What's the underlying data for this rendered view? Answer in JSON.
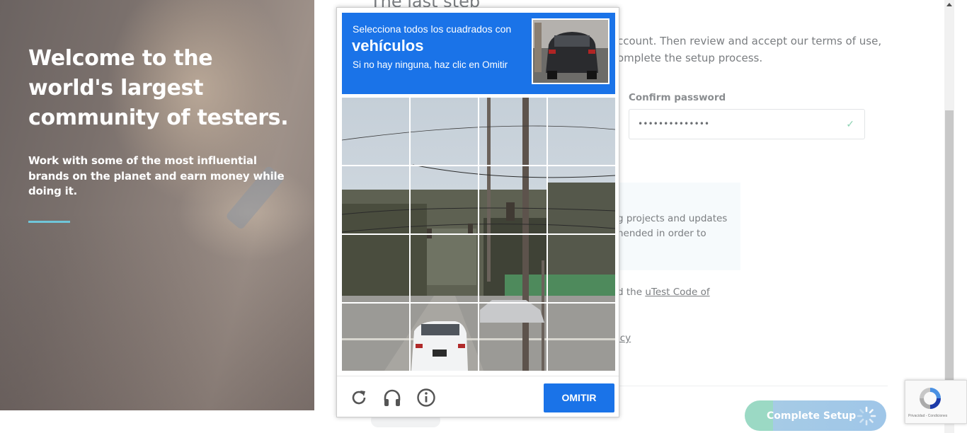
{
  "hero": {
    "headline": "Welcome to the world's largest community of testers.",
    "subtext": "Work with some of the most influential brands on the planet and earn money while doing it."
  },
  "form": {
    "title": "The last step",
    "intro_line1": "ccount. Then review and accept our terms of use,",
    "intro_line2": "omplete the setup process.",
    "confirm_password_label": "Confirm password",
    "confirm_password_value": "••••••••••••••",
    "info_line1": "g projects and updates",
    "info_line2": "nended in order to",
    "code_prefix": "d the",
    "code_link": "uTest Code of",
    "privacy_fragment": "icy",
    "complete_setup_label": "Complete Setup"
  },
  "captcha": {
    "instruction": "Selecciona todos los cuadrados con",
    "target": "vehículos",
    "hint": "Si no hay ninguna, haz clic en Omitir",
    "skip_label": "OMITIR",
    "grid_size": 4,
    "footer_icons": [
      "reload-icon",
      "audio-icon",
      "info-icon"
    ],
    "colors": {
      "accent": "#1a73e8"
    }
  },
  "recaptcha_badge": {
    "legal_text": "Privacidad - Condiciones"
  },
  "colors": {
    "hero_accent": "#6fc6d9",
    "setup_button": "#9fc6e8",
    "check": "#8fd3b4"
  }
}
